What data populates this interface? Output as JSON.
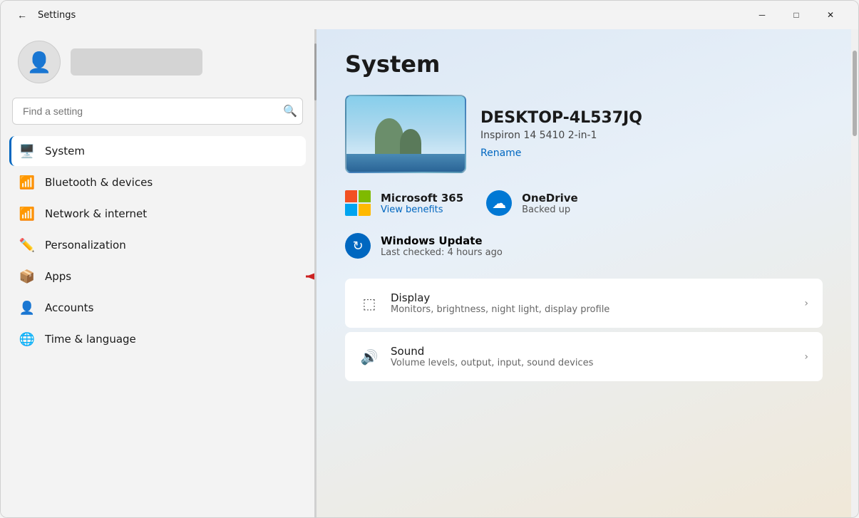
{
  "window": {
    "title": "Settings",
    "titlebar_back_label": "←",
    "minimize_label": "─",
    "maximize_label": "□",
    "close_label": "✕"
  },
  "sidebar": {
    "search_placeholder": "Find a setting",
    "nav_items": [
      {
        "id": "system",
        "label": "System",
        "icon": "🖥️",
        "active": true
      },
      {
        "id": "bluetooth",
        "label": "Bluetooth & devices",
        "icon": "🔵",
        "active": false
      },
      {
        "id": "network",
        "label": "Network & internet",
        "icon": "📶",
        "active": false
      },
      {
        "id": "personalization",
        "label": "Personalization",
        "icon": "✏️",
        "active": false
      },
      {
        "id": "apps",
        "label": "Apps",
        "icon": "📦",
        "active": false
      },
      {
        "id": "accounts",
        "label": "Accounts",
        "icon": "👤",
        "active": false
      },
      {
        "id": "time",
        "label": "Time & language",
        "icon": "🌐",
        "active": false
      }
    ]
  },
  "main": {
    "page_title": "System",
    "device_name": "DESKTOP-4L537JQ",
    "device_model": "Inspiron 14 5410 2-in-1",
    "rename_label": "Rename",
    "microsoft365": {
      "title": "Microsoft 365",
      "subtitle": "View benefits"
    },
    "onedrive": {
      "title": "OneDrive",
      "subtitle": "Backed up"
    },
    "windows_update": {
      "title": "Windows Update",
      "subtitle": "Last checked: 4 hours ago"
    },
    "settings_items": [
      {
        "id": "display",
        "icon": "🖥",
        "title": "Display",
        "subtitle": "Monitors, brightness, night light, display profile"
      },
      {
        "id": "sound",
        "icon": "🔊",
        "title": "Sound",
        "subtitle": "Volume levels, output, input, sound devices"
      }
    ]
  },
  "annotation": {
    "arrow_label": "← Apps"
  }
}
